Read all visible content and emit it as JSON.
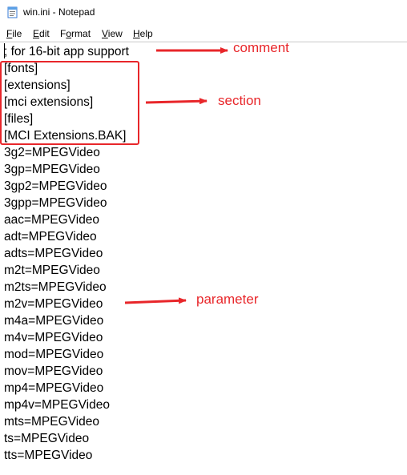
{
  "window": {
    "title": "win.ini - Notepad"
  },
  "menu": {
    "items": [
      {
        "label_acc": "F",
        "label_rest": "ile"
      },
      {
        "label_acc": "E",
        "label_rest": "dit"
      },
      {
        "label_pre": "F",
        "label_acc": "o",
        "label_rest": "rmat"
      },
      {
        "label_acc": "V",
        "label_rest": "iew"
      },
      {
        "label_acc": "H",
        "label_rest": "elp"
      }
    ]
  },
  "editor": {
    "lines": [
      "; for 16-bit app support",
      "[fonts]",
      "[extensions]",
      "[mci extensions]",
      "[files]",
      "[MCI Extensions.BAK]",
      "3g2=MPEGVideo",
      "3gp=MPEGVideo",
      "3gp2=MPEGVideo",
      "3gpp=MPEGVideo",
      "aac=MPEGVideo",
      "adt=MPEGVideo",
      "adts=MPEGVideo",
      "m2t=MPEGVideo",
      "m2ts=MPEGVideo",
      "m2v=MPEGVideo",
      "m4a=MPEGVideo",
      "m4v=MPEGVideo",
      "mod=MPEGVideo",
      "mov=MPEGVideo",
      "mp4=MPEGVideo",
      "mp4v=MPEGVideo",
      "mts=MPEGVideo",
      "ts=MPEGVideo",
      "tts=MPEGVideo"
    ]
  },
  "annotations": {
    "comment": "comment",
    "section": "section",
    "parameter": "parameter",
    "color": "#e8262a"
  },
  "icons": {
    "app": "notepad-icon"
  }
}
